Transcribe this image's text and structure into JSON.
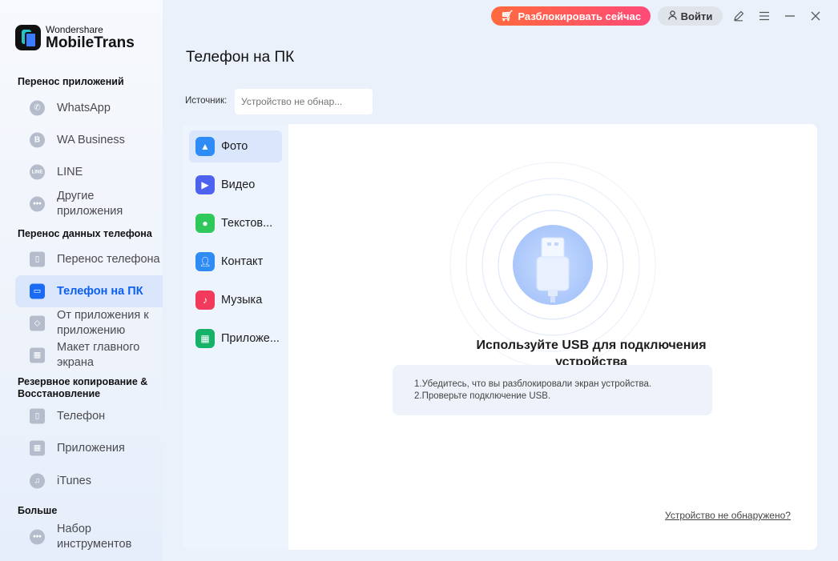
{
  "app": {
    "brand_small": "Wondershare",
    "brand_big": "MobileTrans"
  },
  "topbar": {
    "unlock_label": "Разблокировать сейчас",
    "login_label": "Войти"
  },
  "sidebar": {
    "sections": [
      {
        "title": "Перенос приложений"
      },
      {
        "title": "Перенос данных телефона"
      },
      {
        "title": "Резервное копирование & Восстановление"
      },
      {
        "title": "Больше"
      }
    ],
    "items": [
      {
        "label": "WhatsApp",
        "icon": "whatsapp-icon"
      },
      {
        "label": "WA Business",
        "icon": "wa-business-icon"
      },
      {
        "label": "LINE",
        "icon": "line-icon"
      },
      {
        "label": "Другие приложения",
        "icon": "more-apps-icon"
      },
      {
        "label": "Перенос телефона",
        "icon": "phone-transfer-icon"
      },
      {
        "label": "Телефон на ПК",
        "icon": "phone-to-pc-icon",
        "active": true
      },
      {
        "label": "От приложения к приложению",
        "icon": "app-to-app-icon"
      },
      {
        "label": "Макет главного экрана",
        "icon": "home-layout-icon"
      },
      {
        "label": "Телефон",
        "icon": "phone-backup-icon"
      },
      {
        "label": "Приложения",
        "icon": "apps-backup-icon"
      },
      {
        "label": "iTunes",
        "icon": "itunes-icon"
      },
      {
        "label": "Набор инструментов",
        "icon": "toolkit-icon"
      }
    ]
  },
  "main": {
    "title": "Телефон на ПК",
    "source_label": "Источник:",
    "source_placeholder": "Устройство не обнар...",
    "categories": [
      {
        "label": "Фото",
        "icon": "photo-icon",
        "color": "#2f8cf6",
        "active": true
      },
      {
        "label": "Видео",
        "icon": "video-icon",
        "color": "#4d63f0"
      },
      {
        "label": "Текстов...",
        "icon": "messages-icon",
        "color": "#2fc85a"
      },
      {
        "label": "Контакт",
        "icon": "contact-icon",
        "color": "#2f8cf6"
      },
      {
        "label": "Музыка",
        "icon": "music-icon",
        "color": "#f23b5c"
      },
      {
        "label": "Приложе...",
        "icon": "apps-icon",
        "color": "#17b26a"
      }
    ],
    "usb_title": "Используйте USB для подключения устройства",
    "tips": [
      "1.Убедитесь, что вы разблокировали экран устройства.",
      "2.Проверьте подключение USB."
    ],
    "not_found_link": "Устройство не обнаружено?"
  },
  "colors": {
    "accent": "#1a6af2",
    "unlock_gradient_start": "#ff6a3d",
    "unlock_gradient_end": "#ff4a78"
  }
}
